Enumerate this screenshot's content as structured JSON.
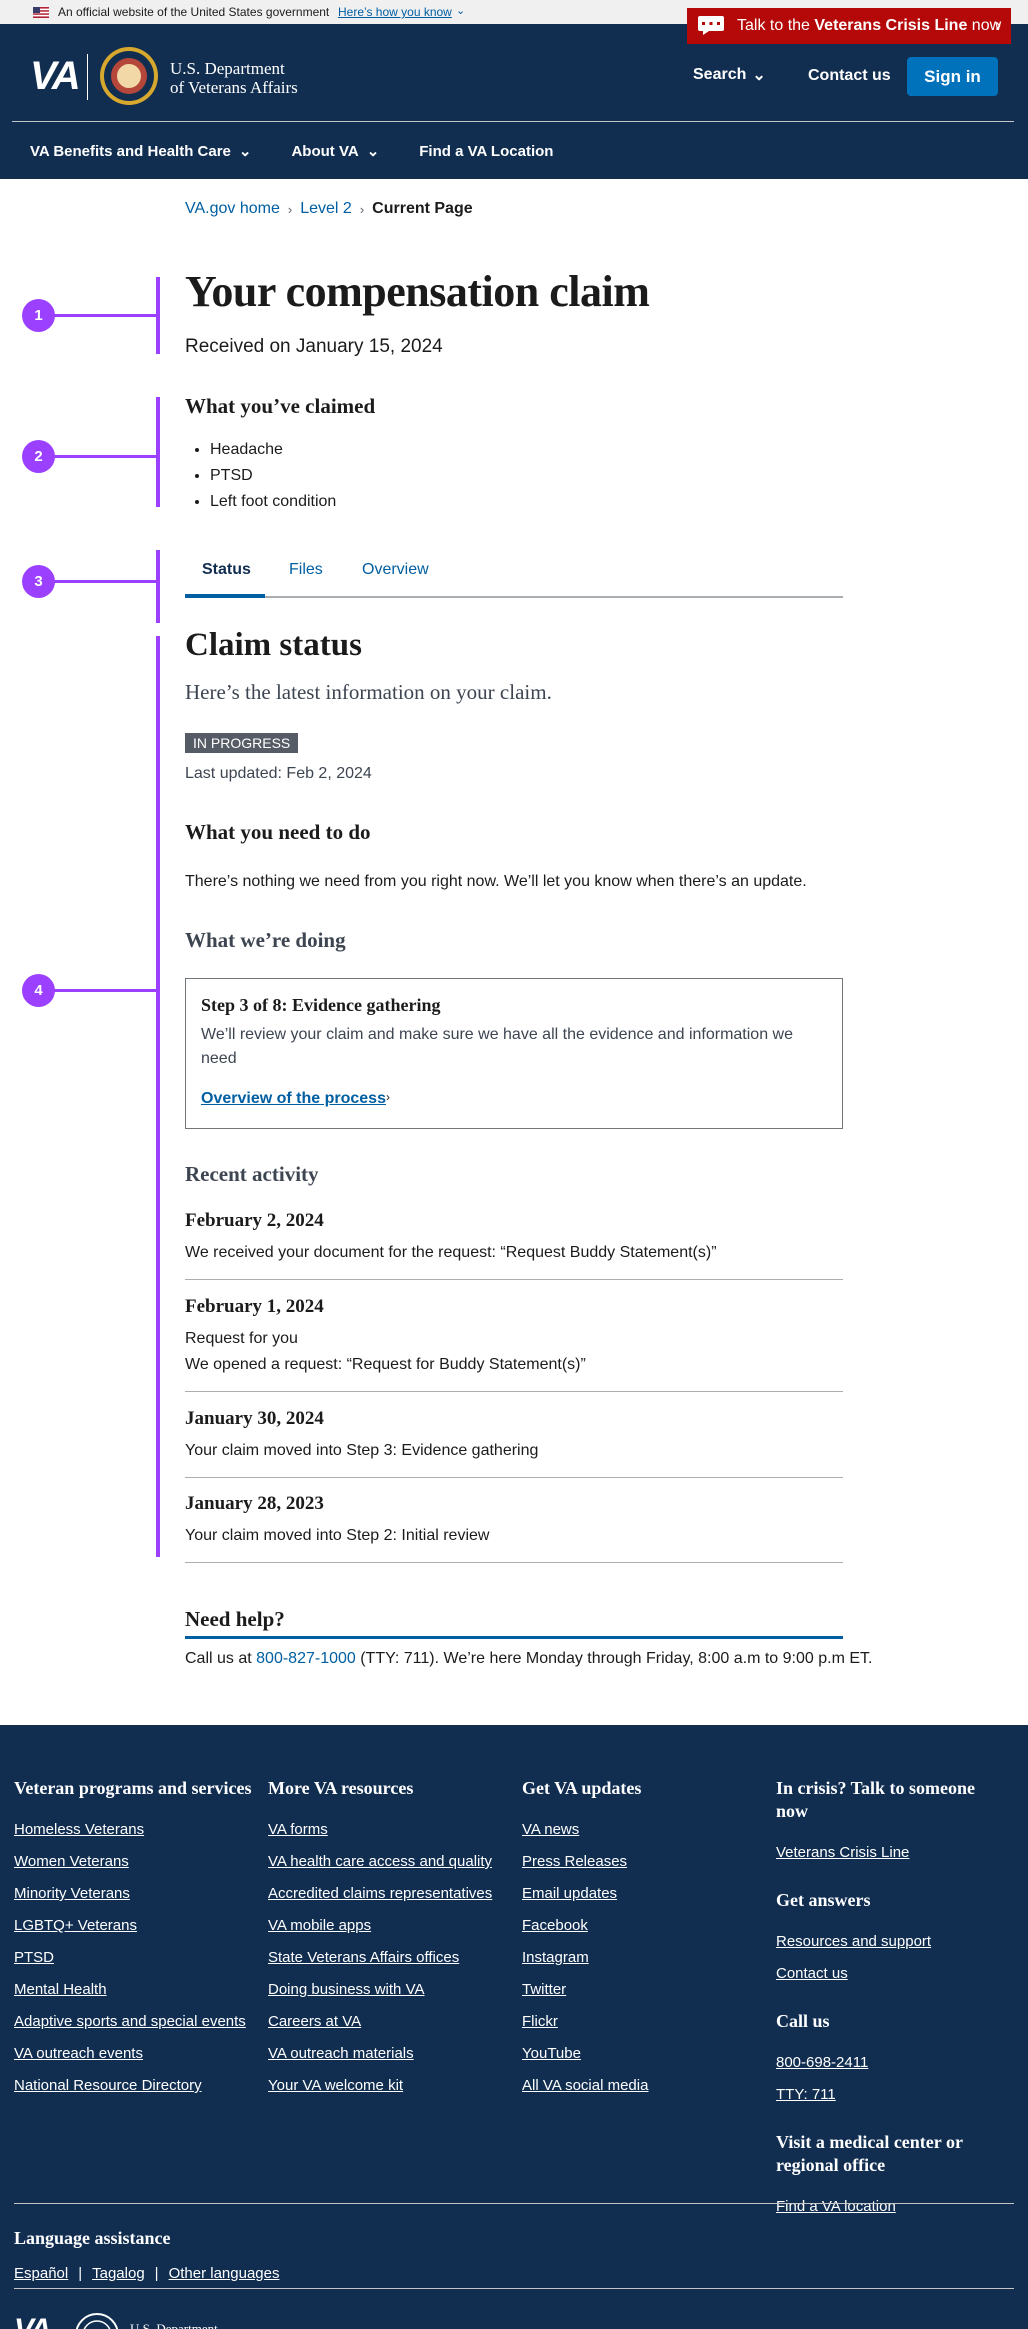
{
  "gov_banner": {
    "text": "An official website of the United States government",
    "link": "Here’s how you know"
  },
  "crisis": {
    "prefix": "Talk to the ",
    "bold": "Veterans Crisis Line",
    "suffix": " now"
  },
  "header": {
    "logo_text": "VA",
    "dept_line1": "U.S. Department",
    "dept_line2": "of Veterans Affairs",
    "search": "Search",
    "contact": "Contact us",
    "signin": "Sign in",
    "nav": [
      "VA Benefits and Health Care",
      "About VA",
      "Find a VA Location"
    ]
  },
  "breadcrumb": {
    "home": "VA.gov home",
    "level2": "Level 2",
    "current": "Current Page"
  },
  "claim": {
    "title": "Your compensation claim",
    "received": "Received on January 15, 2024",
    "claimed_heading": "What you’ve claimed",
    "conditions": [
      "Headache",
      "PTSD",
      "Left foot condition"
    ]
  },
  "tabs": [
    "Status",
    "Files",
    "Overview"
  ],
  "status": {
    "heading": "Claim status",
    "subheading": "Here’s the latest information on your claim.",
    "badge": "IN PROGRESS",
    "updated": "Last updated: Feb 2, 2024",
    "need_heading": "What you need to do",
    "need_text": "There’s nothing we need from you right now. We’ll let you know when there’s an update.",
    "doing_heading": "What we’re doing",
    "step_title": "Step 3 of 8: Evidence gathering",
    "step_desc": "We’ll review your claim and make sure we have all the evidence and information we need",
    "step_link": "Overview of the process",
    "recent_heading": "Recent activity",
    "activity": [
      {
        "date": "February 2, 2024",
        "lines": [
          "We received your document for the request: “Request Buddy Statement(s)”"
        ]
      },
      {
        "date": "February 1, 2024",
        "lines": [
          "Request for you",
          "We opened a request: “Request for Buddy Statement(s)”"
        ]
      },
      {
        "date": "January 30, 2024",
        "lines": [
          "Your claim moved into Step 3: Evidence gathering"
        ]
      },
      {
        "date": "January 28, 2023",
        "lines": [
          "Your claim moved into Step 2: Initial review"
        ]
      }
    ]
  },
  "help": {
    "heading": "Need help?",
    "pre": "Call us at ",
    "phone": "800-827-1000",
    "post": " (TTY: 711). We’re here Monday through Friday, 8:00 a.m to 9:00 p.m ET."
  },
  "annotations": [
    "1",
    "2",
    "3",
    "4"
  ],
  "footer": {
    "col1": {
      "heading": "Veteran programs and services",
      "links": [
        "Homeless Veterans",
        "Women Veterans",
        "Minority Veterans",
        "LGBTQ+ Veterans",
        "PTSD",
        "Mental Health",
        "Adaptive sports and special events",
        "VA outreach events",
        "National Resource Directory"
      ]
    },
    "col2": {
      "heading": "More VA resources",
      "links": [
        "VA forms",
        "VA health care access and quality",
        "Accredited claims representatives",
        "VA mobile apps",
        "State Veterans Affairs offices",
        "Doing business with VA",
        "Careers at VA",
        "VA outreach materials",
        "Your VA welcome kit"
      ]
    },
    "col3": {
      "heading": "Get VA updates",
      "links": [
        "VA news",
        "Press Releases",
        "Email updates",
        "Facebook",
        "Instagram",
        "Twitter",
        "Flickr",
        "YouTube",
        "All VA social media"
      ]
    },
    "col4": {
      "crisis_heading": "In crisis? Talk to someone now",
      "crisis_link": "Veterans Crisis Line",
      "answers_heading": "Get answers",
      "answers_links": [
        "Resources and support",
        "Contact us"
      ],
      "call_heading": "Call us",
      "call_links": [
        "800-698-2411",
        "TTY: 711"
      ],
      "visit_heading": "Visit a medical center or regional office",
      "visit_link": "Find a VA location"
    },
    "language_heading": "Language assistance",
    "languages": [
      "Español",
      "Tagalog",
      "Other languages"
    ],
    "logo_text": "VA",
    "dept_line1": "U.S. Department"
  }
}
